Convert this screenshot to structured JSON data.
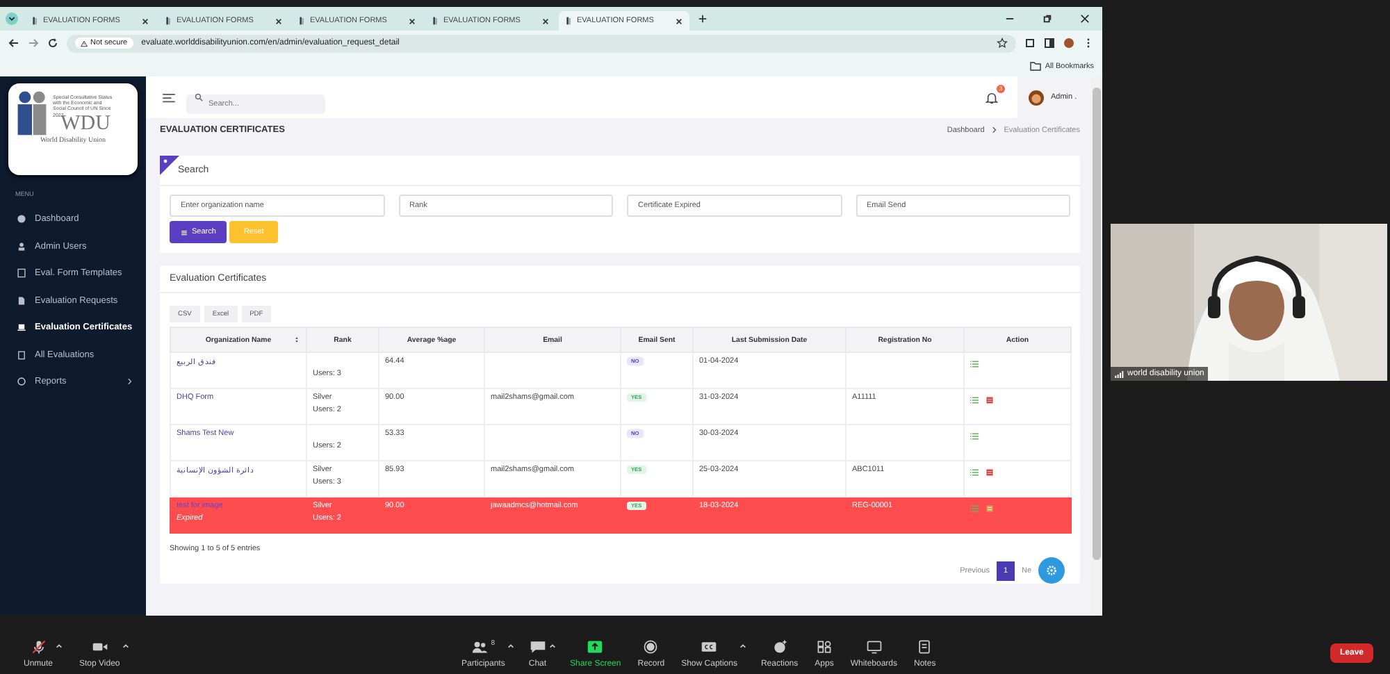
{
  "browser": {
    "tabs": [
      {
        "label": "EVALUATION FORMS",
        "selected": false
      },
      {
        "label": "EVALUATION FORMS",
        "selected": false
      },
      {
        "label": "EVALUATION FORMS",
        "selected": false
      },
      {
        "label": "EVALUATION FORMS",
        "selected": false
      },
      {
        "label": "EVALUATION FORMS",
        "selected": true
      }
    ],
    "security": "Not secure",
    "url": "evaluate.worlddisabilityunion.com/en/admin/evaluation_request_detail",
    "bookmarks": "All Bookmarks"
  },
  "sidebar": {
    "logo": {
      "caption": "Special Consultative Status with the Economic and Social Council of UN Since 2022",
      "mark": "WDU",
      "name": "World Disability Union"
    },
    "menu_label": "MENU",
    "items": [
      {
        "label": "Dashboard",
        "kind": "globe",
        "selected": false,
        "expandable": false
      },
      {
        "label": "Admin Users",
        "kind": "person",
        "selected": false,
        "expandable": false
      },
      {
        "label": "Eval. Form Templates",
        "kind": "form",
        "selected": false,
        "expandable": false
      },
      {
        "label": "Evaluation Requests",
        "kind": "doc",
        "selected": false,
        "expandable": false
      },
      {
        "label": "Evaluation Certificates",
        "kind": "laptop",
        "selected": true,
        "expandable": false
      },
      {
        "label": "All Evaluations",
        "kind": "clipboard",
        "selected": false,
        "expandable": false
      },
      {
        "label": "Reports",
        "kind": "circle",
        "selected": false,
        "expandable": true
      }
    ]
  },
  "topbar": {
    "search_placeholder": "Search...",
    "notification_count": "3",
    "user": "Admin ."
  },
  "page_title": "EVALUATION CERTIFICATES",
  "breadcrumb": [
    "Dashboard",
    "Evaluation Certificates"
  ],
  "search_card": {
    "title": "Search",
    "fields": [
      {
        "placeholder": "Enter organization name"
      },
      {
        "placeholder": "Rank"
      },
      {
        "placeholder": "Certificate Expired"
      },
      {
        "placeholder": "Email Send"
      }
    ],
    "buttons": [
      {
        "label": "Search",
        "kind": "primary"
      },
      {
        "label": "Reset",
        "kind": "warning"
      }
    ]
  },
  "certificates": {
    "title": "Evaluation Certificates",
    "exports": [
      "CSV",
      "Excel",
      "PDF"
    ],
    "columns": [
      "Organization Name",
      "Rank",
      "Average %age",
      "Email",
      "Email Sent",
      "Last Submission Date",
      "Registration No",
      "Action"
    ],
    "rows": [
      {
        "name": "فندق الربيع",
        "expired": false,
        "users": "Users: 3",
        "average": "64.44",
        "email_sent": "NO",
        "date": "01-04-2024",
        "certificate": false
      },
      {
        "name": "DHQ Form",
        "expired": false,
        "rank": "Silver",
        "users": "Users: 2",
        "average": "90.00",
        "email": "mail2shams@gmail.com",
        "email_sent": "YES",
        "date": "31-03-2024",
        "registration": "A11111",
        "certificate": true
      },
      {
        "name": "Shams Test New",
        "expired": false,
        "users": "Users: 2",
        "average": "53.33",
        "email_sent": "NO",
        "date": "30-03-2024",
        "certificate": false
      },
      {
        "name": "دائرة الشؤون الإنسانية",
        "expired": false,
        "rank": "Silver",
        "users": "Users: 3",
        "average": "85.93",
        "email": "mail2shams@gmail.com",
        "email_sent": "YES",
        "date": "25-03-2024",
        "registration": "ABC1011",
        "certificate": true
      },
      {
        "name": "test for image",
        "status": "Expired",
        "expired": true,
        "rank": "Silver",
        "users": "Users: 2",
        "average": "90.00",
        "email": "jawaadmcs@hotmail.com",
        "email_sent": "YES",
        "date": "18-03-2024",
        "registration": "REG-00001",
        "certificate": true
      }
    ],
    "info": "Showing 1 to 5 of 5 entries",
    "previous": "Previous",
    "pages": [
      {
        "label": "1",
        "selected": true
      }
    ],
    "next": "Ne"
  },
  "video": {
    "name": "world disability union"
  },
  "toolbar": {
    "left": [
      {
        "label": "Unmute",
        "kind": "mic",
        "muted": true,
        "caret": true
      },
      {
        "label": "Stop Video",
        "kind": "video",
        "muted": false,
        "caret": true
      }
    ],
    "center": [
      {
        "label": "Participants",
        "kind": "people",
        "count": "8",
        "caret": true
      },
      {
        "label": "Chat",
        "kind": "chat",
        "caret": true
      },
      {
        "label": "Share Screen",
        "kind": "share",
        "caret": false
      },
      {
        "label": "Record",
        "kind": "record",
        "caret": false
      },
      {
        "label": "Show Captions",
        "kind": "cc",
        "caret": true
      },
      {
        "label": "Reactions",
        "kind": "reaction",
        "caret": false
      },
      {
        "label": "Apps",
        "kind": "apps",
        "caret": false
      },
      {
        "label": "Whiteboards",
        "kind": "whiteboard",
        "caret": false
      },
      {
        "label": "Notes",
        "kind": "notes",
        "caret": false
      }
    ],
    "leave": "Leave"
  }
}
